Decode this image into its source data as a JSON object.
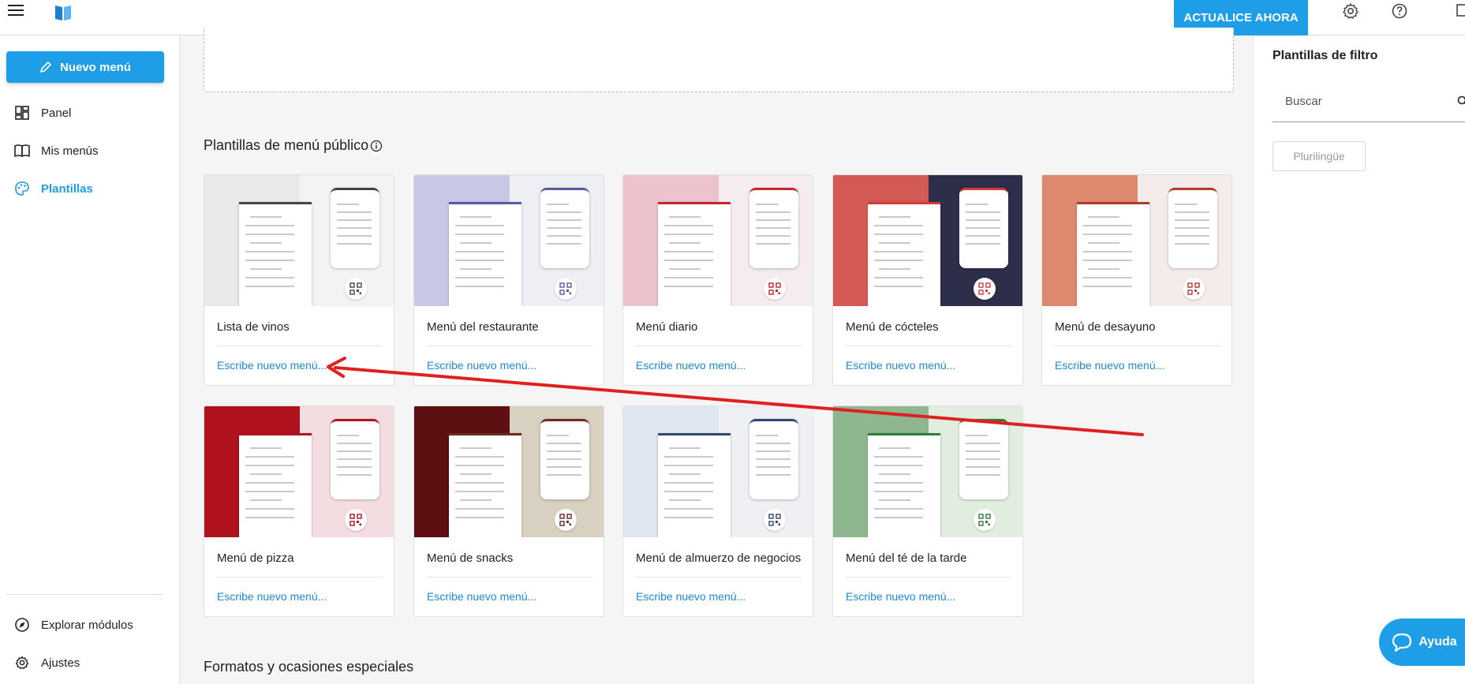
{
  "topbar": {
    "upgrade_label": "ACTUALICE AHORA"
  },
  "sidebar": {
    "new_menu_label": "Nuevo menú",
    "items": [
      {
        "label": "Panel",
        "icon": "dashboard-icon"
      },
      {
        "label": "Mis menús",
        "icon": "book-icon"
      },
      {
        "label": "Plantillas",
        "icon": "palette-icon"
      }
    ],
    "bottom_items": [
      {
        "label": "Explorar módulos",
        "icon": "compass-icon"
      },
      {
        "label": "Ajustes",
        "icon": "gear-icon"
      }
    ]
  },
  "main": {
    "section_title": "Plantillas de menú público",
    "section_title_2": "Formatos y ocasiones especiales",
    "templates": [
      {
        "name": "Lista de vinos",
        "action": "Escribe nuevo menú...",
        "color_left": "#e9e9e9",
        "color_right": "#f3f3f3",
        "accent": "#444444"
      },
      {
        "name": "Menú del restaurante",
        "action": "Escribe nuevo menú...",
        "color_left": "#c8c8e6",
        "color_right": "#eeeef5",
        "accent": "#5a5aa0"
      },
      {
        "name": "Menú diario",
        "action": "Escribe nuevo menú...",
        "color_left": "#ecc3cc",
        "color_right": "#f4ecee",
        "accent": "#c0282e"
      },
      {
        "name": "Menú de cócteles",
        "action": "Escribe nuevo menú...",
        "color_left": "#d45a56",
        "color_right": "#2d2e4a",
        "accent": "#d43c3c"
      },
      {
        "name": "Menú de desayuno",
        "action": "Escribe nuevo menú...",
        "color_left": "#de8870",
        "color_right": "#f4eceb",
        "accent": "#b23a2e"
      },
      {
        "name": "Menú de pizza",
        "action": "Escribe nuevo menú...",
        "color_left": "#b0121e",
        "color_right": "#f4dde0",
        "accent": "#b0121e"
      },
      {
        "name": "Menú de snacks",
        "action": "Escribe nuevo menú...",
        "color_left": "#5e0f12",
        "color_right": "#d8d0c1",
        "accent": "#6a2a22"
      },
      {
        "name": "Menú de almuerzo de negocios",
        "action": "Escribe nuevo menú...",
        "color_left": "#dfe6f0",
        "color_right": "#eef0f3",
        "accent": "#2f4a6e"
      },
      {
        "name": "Menú del té de la tarde",
        "action": "Escribe nuevo menú...",
        "color_left": "#8fb78f",
        "color_right": "#e1eedf",
        "accent": "#2e7d3a"
      }
    ]
  },
  "right_panel": {
    "title": "Plantillas de filtro",
    "search_placeholder": "Buscar",
    "chip_label": "Plurilingüe"
  },
  "help": {
    "label": "Ayuda"
  },
  "colors": {
    "primary": "#1e9ee6",
    "link": "#1e8ad6",
    "annotation_arrow": "#e02020"
  }
}
